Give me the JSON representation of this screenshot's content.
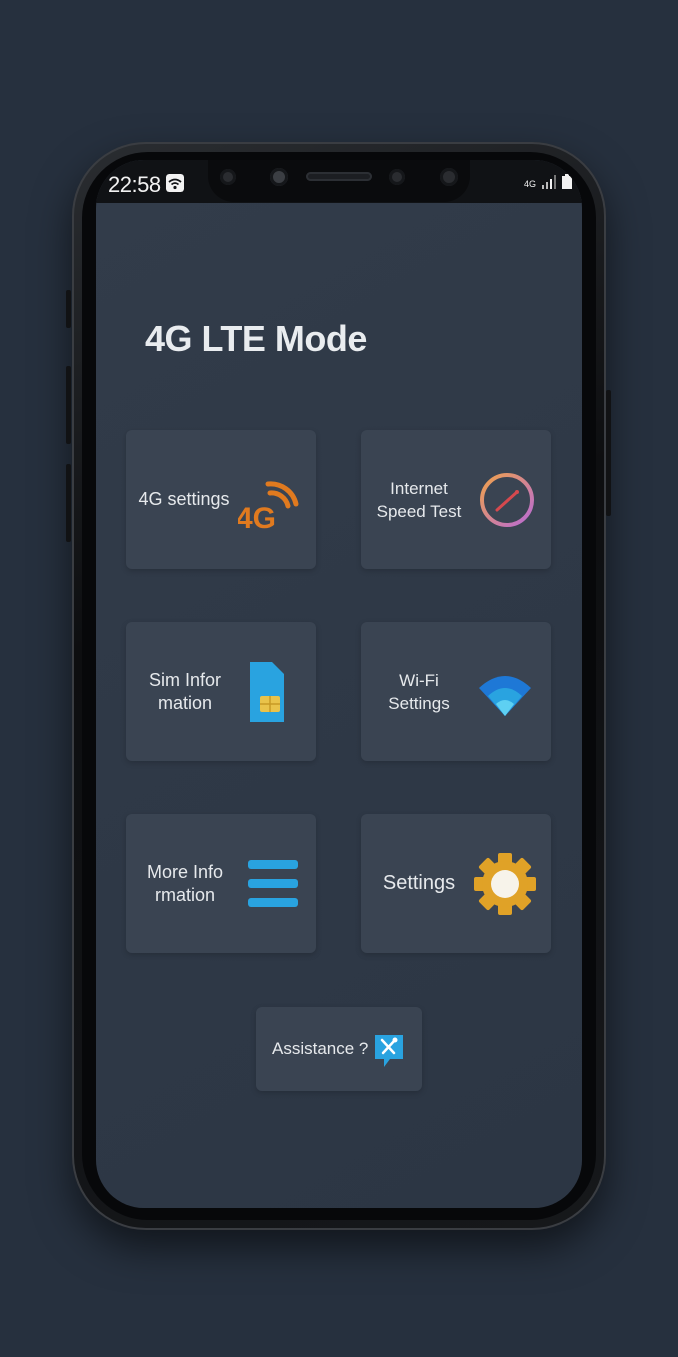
{
  "status_bar": {
    "time": "22:58",
    "network": "4G"
  },
  "app": {
    "title": "4G LTE Mode"
  },
  "cards": [
    {
      "label": "4G settings",
      "icon": "4g-signal-icon"
    },
    {
      "label": "Internet Speed Test",
      "icon": "speedometer-icon"
    },
    {
      "label": "Sim Information",
      "icon": "sim-card-icon"
    },
    {
      "label": "Wi-Fi Settings",
      "icon": "wifi-icon"
    },
    {
      "label": "More Information",
      "icon": "list-menu-icon"
    },
    {
      "label": "Settings",
      "icon": "gear-icon"
    }
  ],
  "assistance": {
    "label": "Assistance ?",
    "icon": "tools-icon"
  },
  "colors": {
    "background": "#26303e",
    "screen": "#303a48",
    "card": "#3a4452",
    "orange": "#e07a1f",
    "blue": "#29a3e0",
    "gold": "#e0a227"
  }
}
